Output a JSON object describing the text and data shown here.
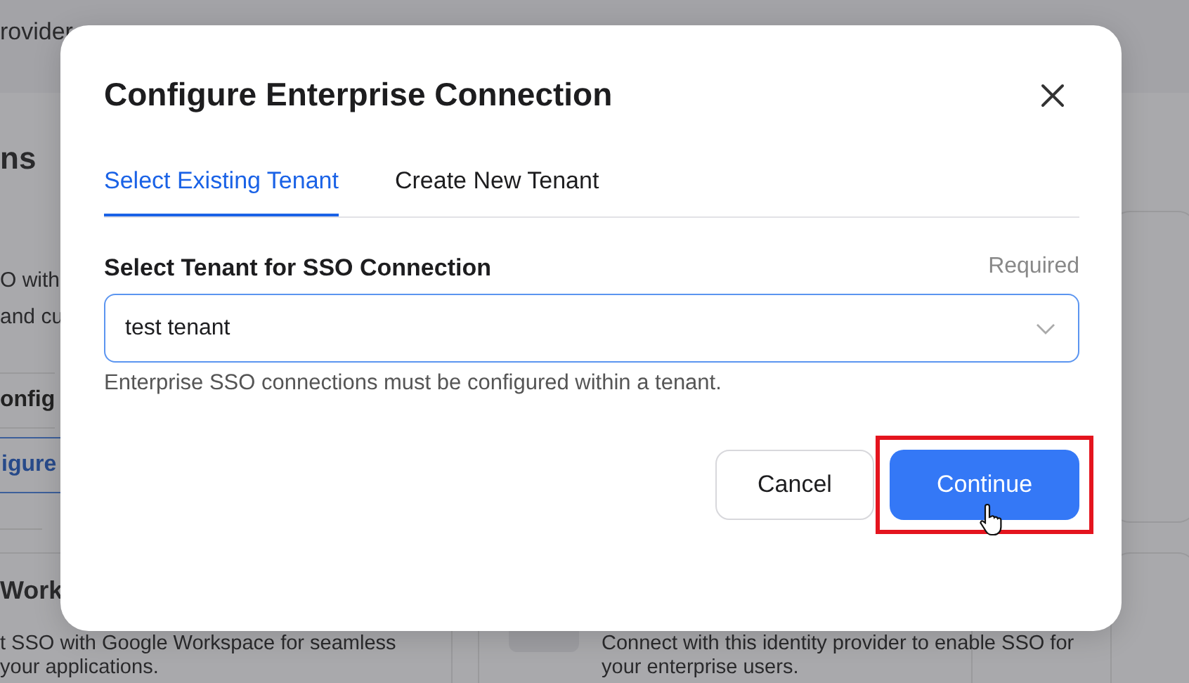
{
  "page": {
    "intro": "rovider",
    "left_panel": {
      "heading": "ns",
      "description": [
        "O with",
        "and cu"
      ],
      "buttons": [
        {
          "label": "onfig",
          "kind": "plain"
        },
        {
          "label": "igure",
          "kind": "outline"
        }
      ]
    },
    "cards": [
      {
        "title": "Work",
        "description": [
          "t SSO with Google Workspace for seamless",
          "your applications."
        ]
      },
      {
        "description": [
          "Connect with this identity provider to enable SSO for",
          "your enterprise users."
        ]
      }
    ]
  },
  "modal": {
    "title": "Configure Enterprise Connection",
    "tabs": [
      {
        "label": "Select Existing Tenant",
        "selected": true
      },
      {
        "label": "Create New Tenant",
        "selected": false
      }
    ],
    "field": {
      "label": "Select Tenant for SSO Connection",
      "required": "Required",
      "value": "test tenant",
      "help": "Enterprise SSO connections must be configured within a tenant."
    },
    "buttons": [
      {
        "label": "Cancel",
        "kind": "secondary"
      },
      {
        "label": "Continue",
        "kind": "primary",
        "highlighted": true
      }
    ]
  }
}
